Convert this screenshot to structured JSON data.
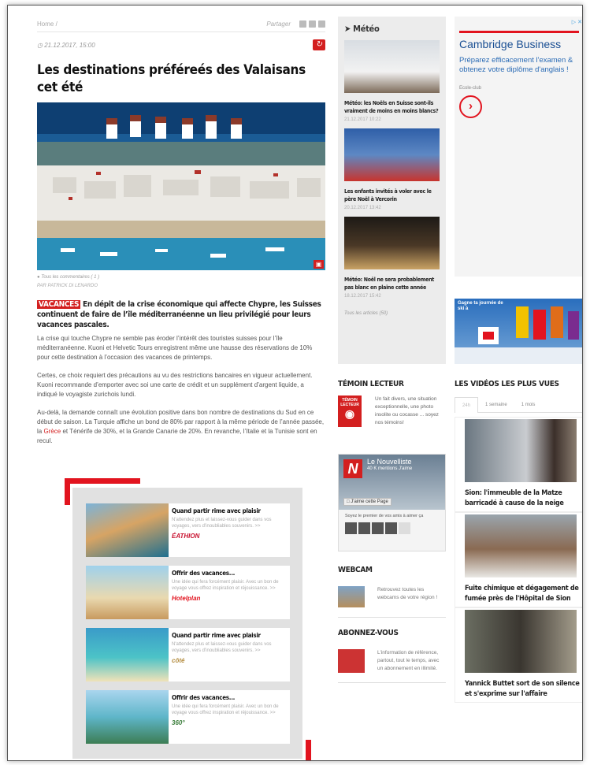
{
  "breadcrumb": "Home /",
  "share_label": "Partager",
  "article": {
    "date": "21.12.2017, 15:00",
    "title": "Les destinations préféreés des Valaisans cet été",
    "comments": "Tous les commentaires ( 1 )",
    "author": "PAR PATRICK DI LENARDO",
    "tag": "VACANCES",
    "lead": "En dépit de la crise économique qui affecte Chypre, les Suisses continuent de faire de l’île méditerranéenne un lieu privilégié pour leurs vacances pascales.",
    "p1": "La crise qui touche Chypre ne semble pas éroder l’intérêt des touristes suisses pour l’île méditerranéenne. Kuoni et Helvetic Tours enregistrent même une hausse des réservations de 10% pour cette destination à l’occasion des vacances de printemps.",
    "p2": "Certes, ce choix requiert des précautions au vu des restrictions bancaires en vigueur actuellement. Kuoni recommande d’emporter avec soi une carte de crédit et un supplément d’argent liquide, a indiqué le voyagiste zurichois lundi.",
    "p3_a": "Au-delà, la demande connaît une évolution positive dans bon nombre de destinations du Sud en ce début de saison. La Turquie affiche un bond de 80% par rapport à la même période de l’année passée, la ",
    "p3_link": "Grèce",
    "p3_b": " et Ténérife de 30%, et la Grande Canarie de 20%. En revanche, l’Italie et la Tunisie sont en recul."
  },
  "promo": [
    {
      "title": "Quand partir rime avec plaisir",
      "desc": "N'attendez plus et laissez-vous guider dans vos voyages, vers d'inoubliables souvenirs. >>",
      "brand": "ÉATHION",
      "brand_color": "#c8102e"
    },
    {
      "title": "Offrir des vacances...",
      "desc": "Une idée qui fera forcément plaisir. Avec un bon de voyage vous offrez inspiration et réjouissance. >>",
      "brand": "Hotelplan",
      "brand_color": "#e2141f"
    },
    {
      "title": "Quand partir rime avec plaisir",
      "desc": "N'attendez plus et laissez-vous guider dans vos voyages, vers d'inoubliables souvenirs. >>",
      "brand": "côté",
      "brand_color": "#b38b3d"
    },
    {
      "title": "Offrir des vacances...",
      "desc": "Une idée qui fera forcément plaisir. Avec un bon de voyage vous offrez inspiration et réjouissance. >>",
      "brand": "360°",
      "brand_color": "#3a7d3a"
    }
  ],
  "meteo": {
    "title": "Météo",
    "items": [
      {
        "caption": "Météo: les Noëls en Suisse sont-ils vraiment de moins en moins blancs?",
        "date": "21.12.2017 10:22"
      },
      {
        "caption": "Les enfants invités à voler avec le père Noël à Vercorin",
        "date": "20.12.2017 13:42"
      },
      {
        "caption": "Météo: Noël ne sera probablement pas blanc en plaine cette année",
        "date": "18.12.2017 15:42"
      }
    ],
    "all": "Tous les articles (50)"
  },
  "temoin": {
    "heading": "TÉMOIN LECTEUR",
    "logo_text": "TÉMOIN LECTEUR",
    "text": "Un fait divers, une situation exceptionnelle, une photo insolite ou cocasse ... soyez nos témoins!"
  },
  "facebook": {
    "name": "Le Nouvelliste",
    "fans": "40 K mentions J'aime",
    "like": "J'aime cette Page",
    "friends": "Soyez le premier de vos amis à aimer ça"
  },
  "webcam": {
    "heading": "WEBCAM",
    "text": "Retrouvez toutes les webcams de votre région !"
  },
  "abo": {
    "heading": "ABONNEZ-VOUS",
    "text": "L'information de référence, partout, tout le temps, avec un abonnement en illimité."
  },
  "ad": {
    "headline": "Cambridge Business",
    "body": "Préparez efficacement l'examen & obtenez votre diplôme d'anglais !",
    "source": "Ecole-club",
    "cta": "›"
  },
  "ski_ad": {
    "text": "Gagne ta journée de ski à"
  },
  "videos": {
    "heading": "LES VIDÉOS LES PLUS VUES",
    "tabs": [
      "24h",
      "1 semaine",
      "1 mois"
    ],
    "items": [
      {
        "title": "Sion: l'immeuble de la Matze barricadé à cause de la neige"
      },
      {
        "title": "Fuite chimique et dégagement de fumée près de l'Hôpital de Sion"
      },
      {
        "title": "Yannick Buttet sort de son silence et s'exprime sur l'affaire"
      }
    ]
  }
}
